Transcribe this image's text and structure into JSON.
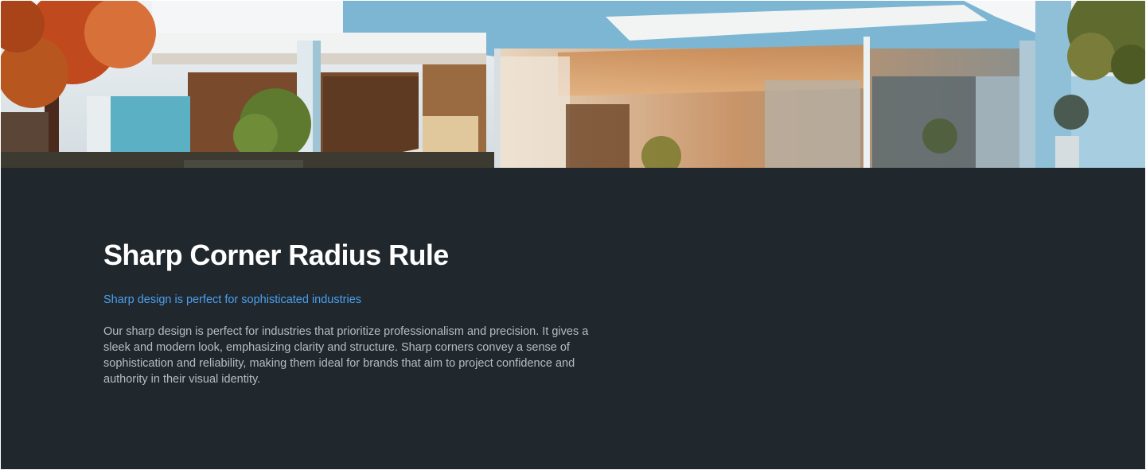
{
  "hero": {
    "image": "modern-house-photo"
  },
  "section": {
    "title": "Sharp Corner Radius Rule",
    "subtitle": "Sharp design is perfect for sophisticated industries",
    "body": "Our sharp design is perfect for industries that prioritize professionalism and precision. It gives a sleek and modern look, emphasizing clarity and structure. Sharp corners convey a sense of sophistication and reliability, making them ideal for brands that aim to project confidence and authority in their visual identity."
  },
  "colors": {
    "background": "#21282d",
    "title": "#ffffff",
    "accent": "#4a9ff0",
    "body_text": "#b7bcc0"
  }
}
